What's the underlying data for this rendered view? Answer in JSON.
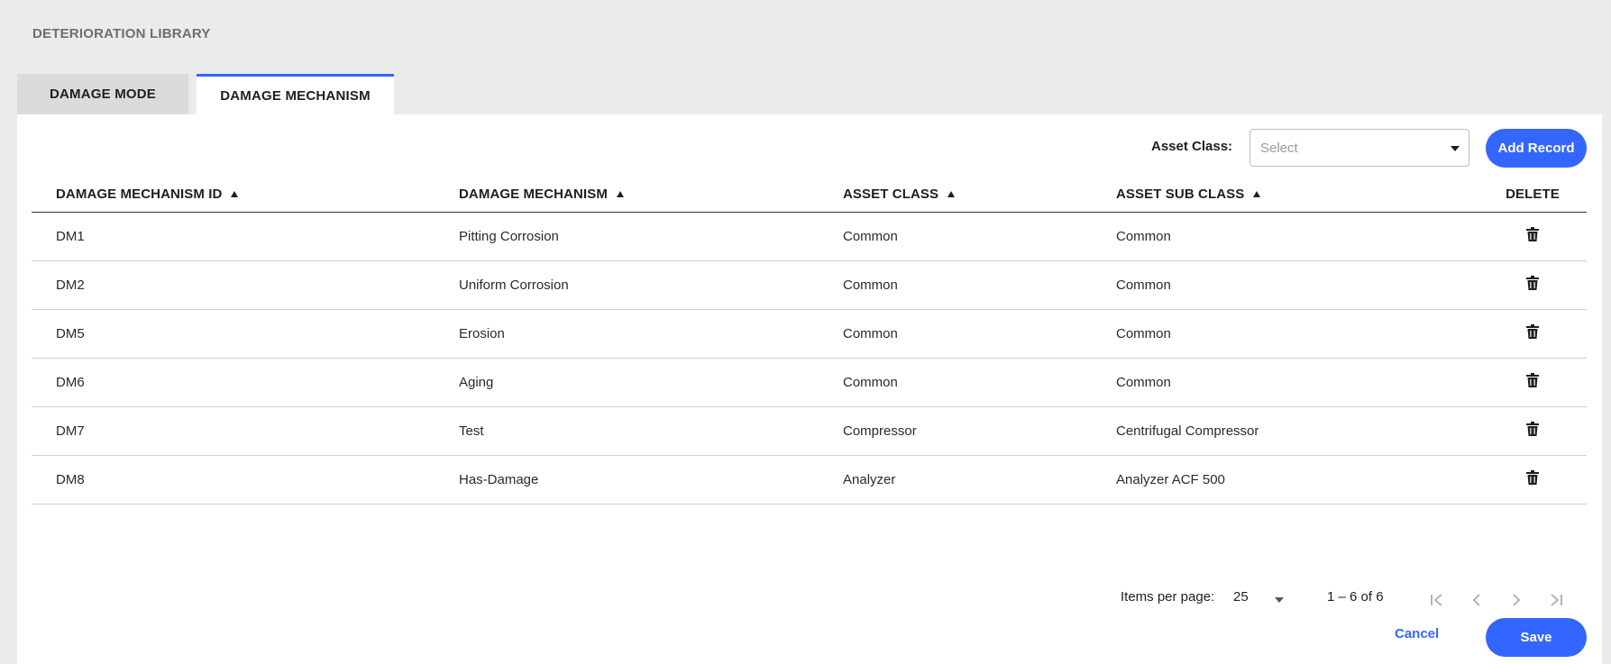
{
  "page": {
    "title": "DETERIORATION LIBRARY"
  },
  "tabs": [
    {
      "label": "DAMAGE MODE",
      "active": false
    },
    {
      "label": "DAMAGE MECHANISM",
      "active": true
    }
  ],
  "toolbar": {
    "asset_class_label": "Asset Class:",
    "asset_class_placeholder": "Select",
    "add_record_label": "Add Record"
  },
  "table": {
    "columns": [
      "DAMAGE MECHANISM ID",
      "DAMAGE MECHANISM",
      "ASSET CLASS",
      "ASSET SUB CLASS",
      "DELETE"
    ],
    "rows": [
      [
        "DM1",
        "Pitting Corrosion",
        "Common",
        "Common"
      ],
      [
        "DM2",
        "Uniform Corrosion",
        "Common",
        "Common"
      ],
      [
        "DM5",
        "Erosion",
        "Common",
        "Common"
      ],
      [
        "DM6",
        "Aging",
        "Common",
        "Common"
      ],
      [
        "DM7",
        "Test",
        "Compressor",
        "Centrifugal Compressor"
      ],
      [
        "DM8",
        "Has-Damage",
        "Analyzer",
        "Analyzer ACF 500"
      ]
    ]
  },
  "pager": {
    "items_label": "Items per page:",
    "items_value": "25",
    "range": "1 – 6 of 6"
  },
  "footer": {
    "cancel_label": "Cancel",
    "save_label": "Save"
  },
  "colors": {
    "accent": "#3366ff",
    "background": "#ebebeb",
    "inactive_tab": "#dbdbdb"
  },
  "icons": {
    "sort": "sort-asc-icon",
    "delete": "trash-icon",
    "dropdown": "chevron-down-icon"
  }
}
